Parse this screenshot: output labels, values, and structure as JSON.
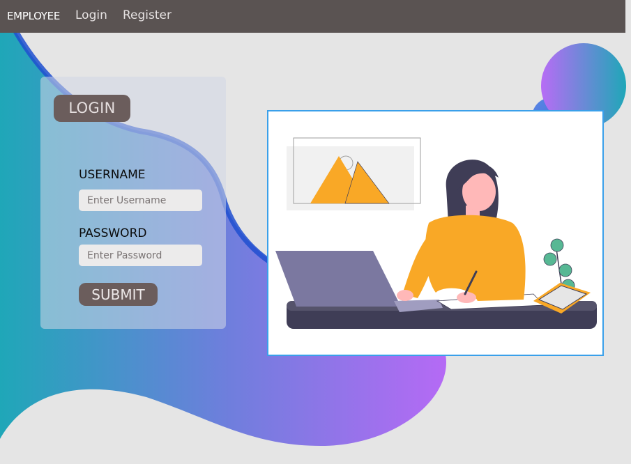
{
  "nav": {
    "brand": "EMPLOYEE",
    "login_link": "Login",
    "register_link": "Register"
  },
  "login_form": {
    "title": "LOGIN",
    "username_label": "USERNAME",
    "username_placeholder": "Enter Username",
    "username_value": "",
    "password_label": "PASSWORD",
    "password_placeholder": "Enter Password",
    "password_value": "",
    "submit_label": "SUBMIT"
  },
  "colors": {
    "navbar": "#5a5352",
    "button": "#6b5d5c",
    "page_background": "#e5e5e5",
    "illustration_border": "#3aa0ea",
    "accent_orange": "#f9a826",
    "blob_gradient_start": "#1fa7b8",
    "blob_gradient_end": "#b56af5"
  },
  "illustration": {
    "icon": "woman-working-on-laptop-illustration"
  }
}
